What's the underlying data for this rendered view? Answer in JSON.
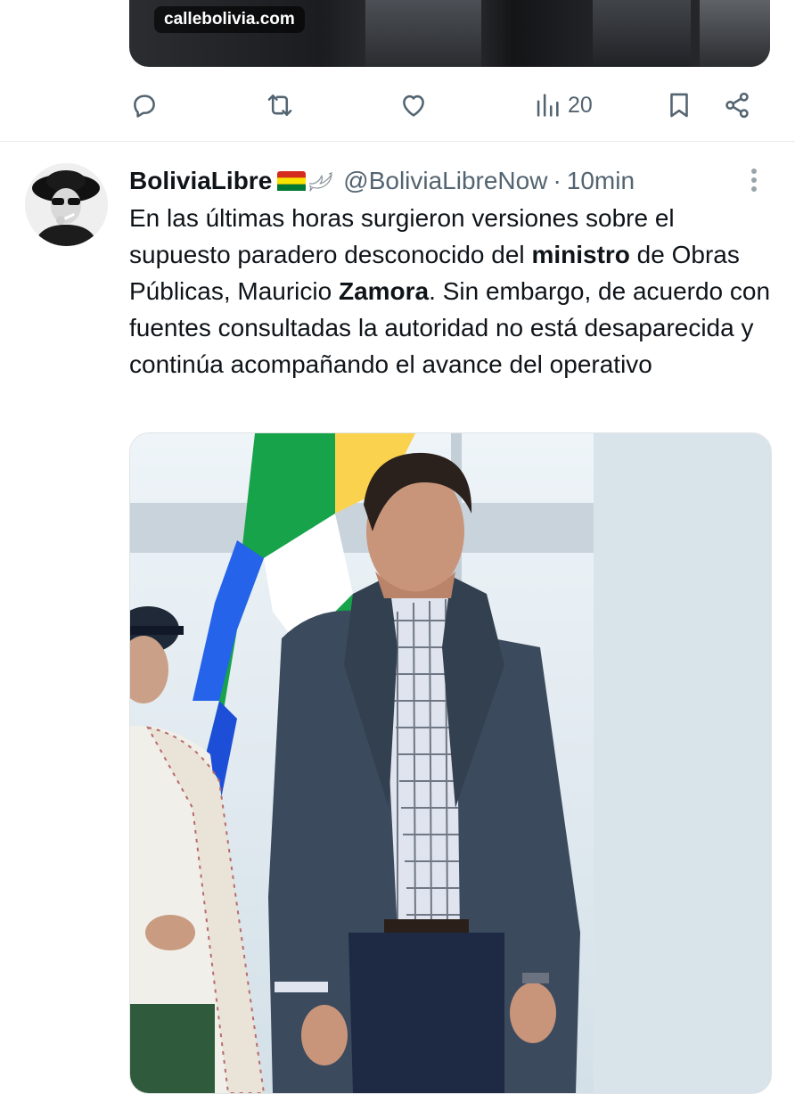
{
  "previous_tweet": {
    "media_source": "callebolivia.com",
    "actions": {
      "views_count": "20"
    }
  },
  "tweet": {
    "display_name": "BoliviaLibre",
    "handle": "@BoliviaLibreNow",
    "separator": "·",
    "time": "10min",
    "text": {
      "p1": "En las últimas horas surgieron versiones sobre el supuesto paradero desconocido del ",
      "b1": "ministro",
      "p2": " de Obras Públicas, Mauricio ",
      "b2": "Zamora",
      "p3": ". Sin embargo, de acuerdo con fuentes consultadas la autoridad no está desaparecida y continúa acompañando el avance del operativo"
    }
  },
  "icons": {
    "reply": "reply-icon",
    "retweet": "retweet-icon",
    "like": "heart-icon",
    "views": "views-chart-icon",
    "bookmark": "bookmark-icon",
    "share": "share-icon",
    "more": "more-vertical-icon",
    "flag": "bolivia-flag-icon",
    "dove": "dove-icon"
  },
  "colors": {
    "secondary_text": "#536471",
    "primary_text": "#0f1419",
    "divider": "#e6e9eb"
  }
}
